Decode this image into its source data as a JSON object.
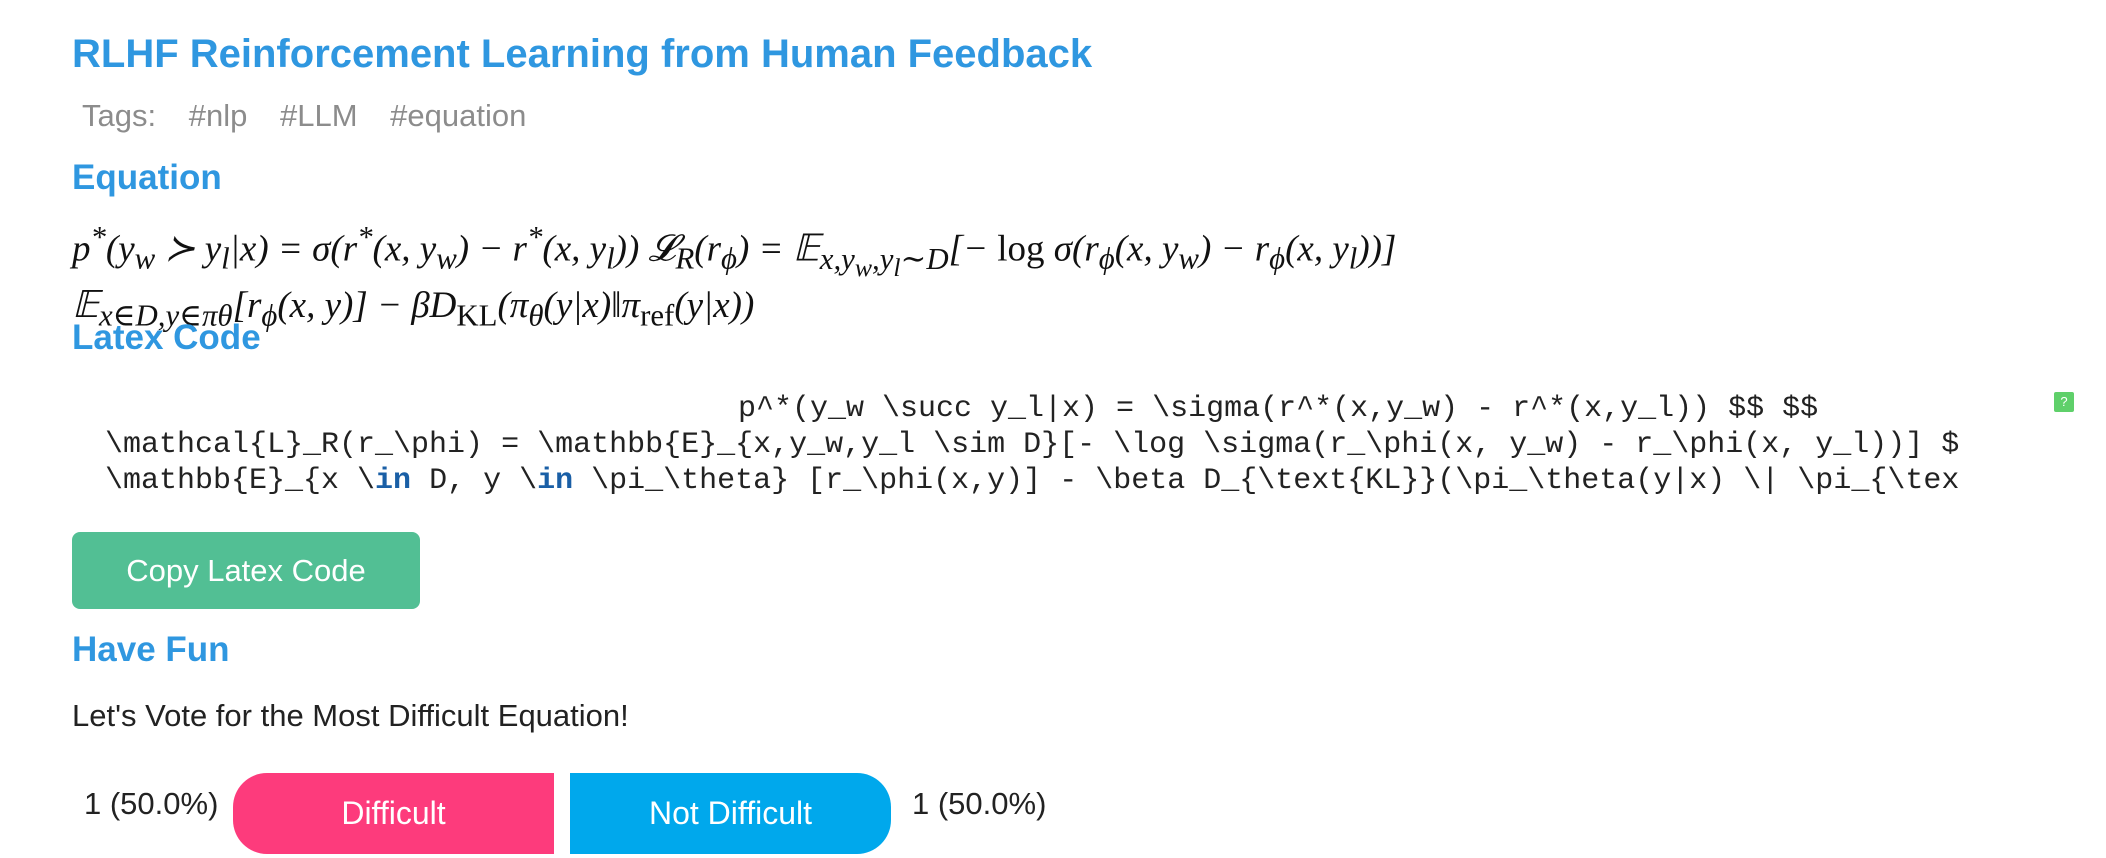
{
  "page": {
    "title": "RLHF Reinforcement Learning from Human Feedback"
  },
  "tags": {
    "label": "Tags:",
    "items": [
      "#nlp",
      "#LLM",
      "#equation"
    ]
  },
  "sections": {
    "equation": "Equation",
    "latex": "Latex Code",
    "fun": "Have Fun"
  },
  "latex": {
    "line1": "p^*(y_w \\succ y_l|x) = \\sigma(r^*(x,y_w) - r^*(x,y_l)) $$ $$",
    "line2": "\\mathcal{L}_R(r_\\phi) = \\mathbb{E}_{x,y_w,y_l \\sim D}[- \\log \\sigma(r_\\phi(x, y_w) - r_\\phi(x, y_l))] $",
    "line3_a": "\\mathbb{E}_{x \\",
    "line3_kw1": "in",
    "line3_b": " D, y \\",
    "line3_kw2": "in",
    "line3_c": " \\pi_\\theta} [r_\\phi(x,y)] - \\beta D_{\\text{KL}}(\\pi_\\theta(y|x) \\| \\pi_{\\tex",
    "help_badge": "?"
  },
  "copy_button": "Copy Latex Code",
  "vote": {
    "prompt": "Let's Vote for the Most Difficult Equation!",
    "difficult_count": "1 (50.0%)",
    "difficult_label": "Difficult",
    "not_difficult_label": "Not Difficult",
    "not_difficult_count": "1 (50.0%)"
  },
  "colors": {
    "heading": "#2f97e0",
    "copy_button": "#52bf94",
    "difficult_button": "#fd3b7c",
    "not_difficult_button": "#00a8ec"
  }
}
